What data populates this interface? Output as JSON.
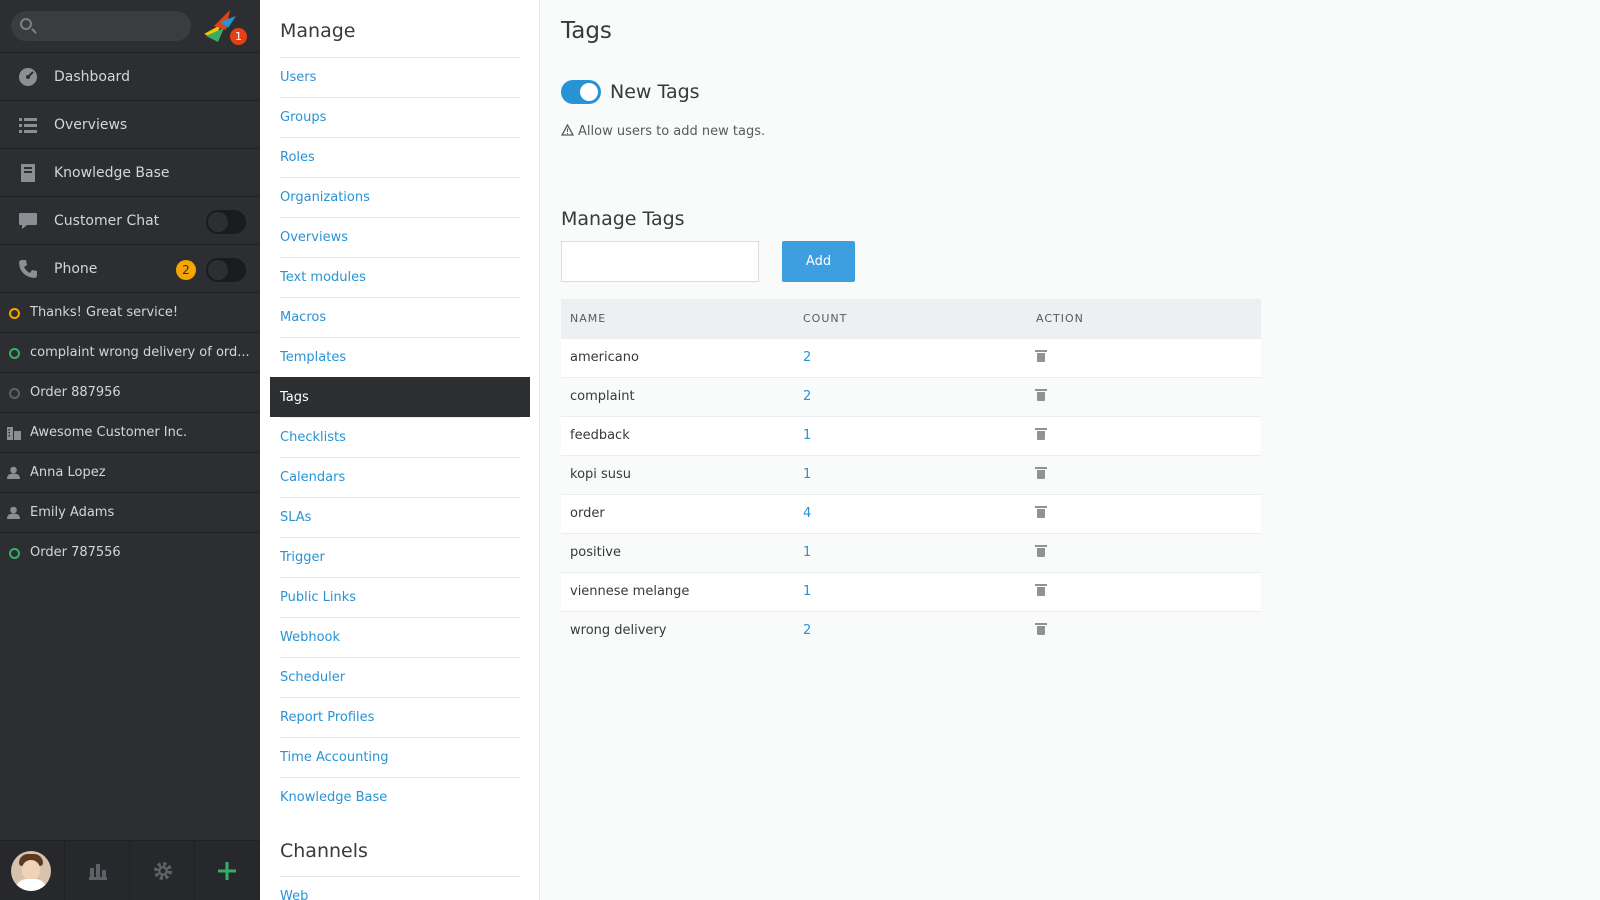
{
  "nav": {
    "notification_count": "1",
    "items": [
      {
        "label": "Dashboard",
        "icon": "dashboard-icon"
      },
      {
        "label": "Overviews",
        "icon": "list-icon"
      },
      {
        "label": "Knowledge Base",
        "icon": "book-icon"
      },
      {
        "label": "Customer Chat",
        "icon": "chat-icon"
      },
      {
        "label": "Phone",
        "icon": "phone-icon",
        "badge": "2"
      }
    ],
    "tasks": [
      {
        "label": "Thanks! Great service!",
        "icon": "ticket-open-icon",
        "color": "#f6a600"
      },
      {
        "label": "complaint wrong delivery of ord...",
        "icon": "ticket-new-icon",
        "color": "#38ad69"
      },
      {
        "label": "Order 887956",
        "icon": "ticket-closed-icon",
        "color": "#5e6266"
      },
      {
        "label": "Awesome Customer Inc.",
        "icon": "organization-icon"
      },
      {
        "label": "Anna Lopez",
        "icon": "person-icon"
      },
      {
        "label": "Emily Adams",
        "icon": "person-icon"
      },
      {
        "label": "Order 787556",
        "icon": "ticket-new-icon",
        "color": "#38ad69"
      }
    ]
  },
  "manage": {
    "heading": "Manage",
    "links": [
      "Users",
      "Groups",
      "Roles",
      "Organizations",
      "Overviews",
      "Text modules",
      "Macros",
      "Templates",
      "Tags",
      "Checklists",
      "Calendars",
      "SLAs",
      "Trigger",
      "Public Links",
      "Webhook",
      "Scheduler",
      "Report Profiles",
      "Time Accounting",
      "Knowledge Base"
    ],
    "active": "Tags",
    "channels_heading": "Channels",
    "channels_first": "Web"
  },
  "main": {
    "title": "Tags",
    "toggle_label": "New Tags",
    "hint": "Allow users to add new tags.",
    "manage_heading": "Manage Tags",
    "add_label": "Add",
    "columns": [
      "NAME",
      "COUNT",
      "ACTION"
    ],
    "rows": [
      {
        "name": "americano",
        "count": "2"
      },
      {
        "name": "complaint",
        "count": "2"
      },
      {
        "name": "feedback",
        "count": "1"
      },
      {
        "name": "kopi susu",
        "count": "1"
      },
      {
        "name": "order",
        "count": "4"
      },
      {
        "name": "positive",
        "count": "1"
      },
      {
        "name": "viennese melange",
        "count": "1"
      },
      {
        "name": "wrong delivery",
        "count": "2"
      }
    ]
  },
  "colors": {
    "accent": "#2893d4",
    "button": "#3d9ee0",
    "nav_bg": "#2c2e31",
    "badge_orange": "#f6a600",
    "plus_green": "#38ad69"
  }
}
